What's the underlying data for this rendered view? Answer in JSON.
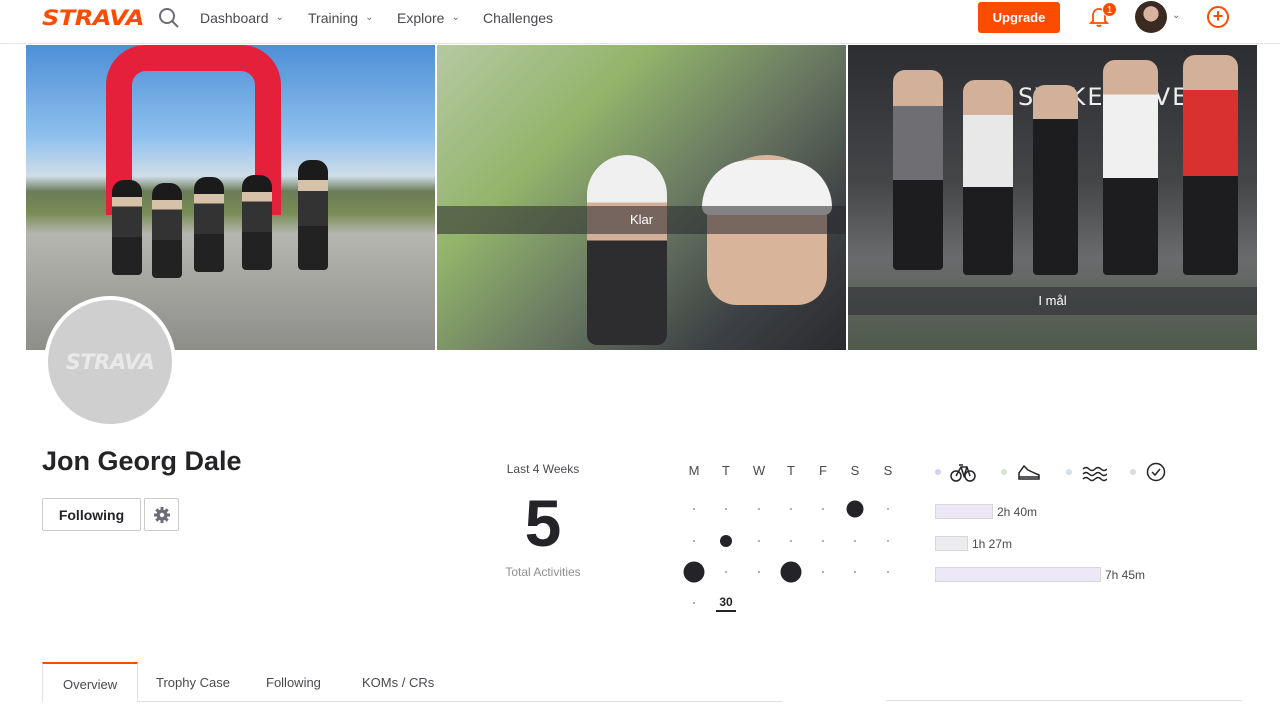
{
  "header": {
    "logo": "STRAVA",
    "nav": [
      {
        "label": "Dashboard"
      },
      {
        "label": "Training"
      },
      {
        "label": "Explore"
      },
      {
        "label": "Challenges"
      }
    ],
    "upgrade_label": "Upgrade",
    "notification_count": "1"
  },
  "photos": [
    {
      "caption": ""
    },
    {
      "caption": "Klar"
    },
    {
      "caption": "I mål"
    }
  ],
  "profile": {
    "avatar_text": "STRAVA",
    "name": "Jon Georg Dale",
    "following_label": "Following"
  },
  "stats": {
    "period_label": "Last 4 Weeks",
    "total": "5",
    "total_label": "Total Activities",
    "day_headers": [
      "M",
      "T",
      "W",
      "T",
      "F",
      "S",
      "S"
    ],
    "today_date": "30"
  },
  "sports": [
    {
      "icon": "bike-icon",
      "color": "#d8cdf0"
    },
    {
      "icon": "run-shoe-icon",
      "color": "#cfe8d2"
    },
    {
      "icon": "swim-icon",
      "color": "#cfe0ea"
    },
    {
      "icon": "clock-icon",
      "color": "#dcdce0"
    }
  ],
  "durations": [
    {
      "label": "2h 40m",
      "color": "#ece8f8"
    },
    {
      "label": "1h 27m",
      "color": "#ececee"
    },
    {
      "label": "7h 45m",
      "color": "#ece8f8"
    }
  ],
  "tabs": [
    {
      "label": "Overview"
    },
    {
      "label": "Trophy Case"
    },
    {
      "label": "Following"
    },
    {
      "label": "KOMs / CRs"
    }
  ]
}
